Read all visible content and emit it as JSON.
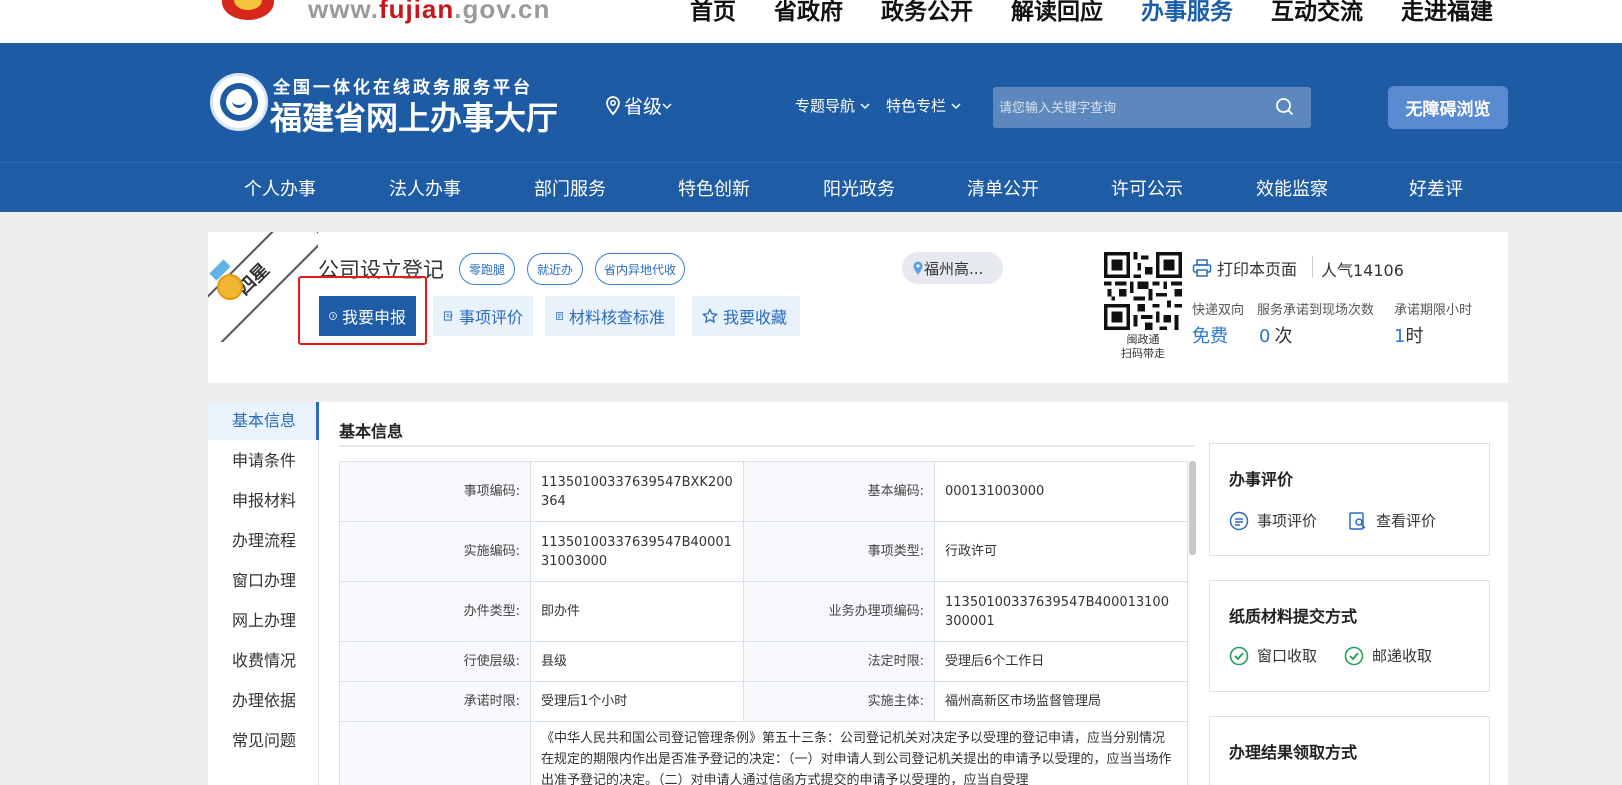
{
  "topbar": {
    "url_prefix": "www.",
    "url_brand": "fujian",
    "url_suffix": ".gov.cn",
    "nav": [
      "首页",
      "省政府",
      "政务公开",
      "解读回应",
      "办事服务",
      "互动交流",
      "走进福建"
    ],
    "active_nav": "办事服务"
  },
  "header": {
    "subtitle": "全国一体化在线政务服务平台",
    "title": "福建省网上办事大厅",
    "region": "省级",
    "links": [
      "专题导航",
      "特色专栏"
    ],
    "search_placeholder": "请您输入关键字查询",
    "a11y": "无障碍浏览"
  },
  "mainnav": [
    "个人办事",
    "法人办事",
    "部门服务",
    "特色创新",
    "阳光政务",
    "清单公开",
    "许可公示",
    "效能监察",
    "好差评"
  ],
  "service": {
    "star_badge": "四星",
    "title": "公司设立登记",
    "tags": [
      "零跑腿",
      "就近办",
      "省内异地代收"
    ],
    "actions": {
      "apply": "我要申报",
      "rate": "事项评价",
      "check": "材料核查标准",
      "favorite": "我要收藏"
    },
    "location": "福州高...",
    "qr_caption_1": "闽政通",
    "qr_caption_2": "扫码带走",
    "print": "打印本页面",
    "popularity": "人气14106",
    "stats": [
      {
        "label": "快递双向",
        "value": "免费",
        "unit": ""
      },
      {
        "label": "服务承诺到现场次数",
        "value": "0",
        "unit": "次"
      },
      {
        "label": "承诺期限小时",
        "value": "1",
        "unit": "时"
      }
    ]
  },
  "sidebar": [
    "基本信息",
    "申请条件",
    "申报材料",
    "办理流程",
    "窗口办理",
    "网上办理",
    "收费情况",
    "办理依据",
    "常见问题"
  ],
  "basic_info": {
    "title": "基本信息",
    "rows": [
      {
        "l1": "事项编码:",
        "v1": "11350100337639547BXK200364",
        "l2": "基本编码:",
        "v2": "000131003000"
      },
      {
        "l1": "实施编码:",
        "v1": "11350100337639547B4000131003000",
        "l2": "事项类型:",
        "v2": "行政许可"
      },
      {
        "l1": "办件类型:",
        "v1": "即办件",
        "l2": "业务办理项编码:",
        "v2": "11350100337639547B400013100300001"
      },
      {
        "l1": "行使层级:",
        "v1": "县级",
        "l2": "法定时限:",
        "v2": "受理后6个工作日"
      },
      {
        "l1": "承诺时限:",
        "v1": "受理后1个小时",
        "l2": "实施主体:",
        "v2": "福州高新区市场监督管理局"
      }
    ],
    "basis_text": "《中华人民共和国公司登记管理条例》第五十三条：公司登记机关对决定予以受理的登记申请，应当分别情况在规定的期限内作出是否准予登记的决定：（一）对申请人到公司登记机关提出的申请予以受理的，应当当场作出准予登记的决定。（二）对申请人通过信函方式提交的申请予以受理的，应当自受理"
  },
  "panels": {
    "evaluation": {
      "title": "办事评价",
      "opt1": "事项评价",
      "opt2": "查看评价"
    },
    "paper": {
      "title": "纸质材料提交方式",
      "opt1": "窗口收取",
      "opt2": "邮递收取"
    },
    "result": {
      "title": "办理结果领取方式"
    }
  },
  "colors": {
    "brand_blue": "#1e5ba5",
    "accent_blue": "#2a6bc0",
    "highlight_red": "#e81818",
    "check_green": "#25a05a"
  }
}
